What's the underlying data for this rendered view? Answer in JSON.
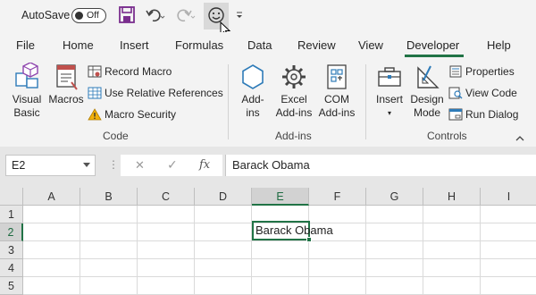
{
  "qat": {
    "autosave_label": "AutoSave",
    "autosave_state": "Off",
    "icons": [
      "save-icon",
      "undo-icon",
      "redo-icon",
      "smiley-icon",
      "customize-dropdown-icon"
    ]
  },
  "tabs": [
    "File",
    "Home",
    "Insert",
    "Formulas",
    "Data",
    "Review",
    "View",
    "Developer",
    "Help"
  ],
  "active_tab": "Developer",
  "ribbon": {
    "code": {
      "visual_basic_line1": "Visual",
      "visual_basic_line2": "Basic",
      "macros": "Macros",
      "record_macro": "Record Macro",
      "use_relative_references": "Use Relative References",
      "macro_security": "Macro Security",
      "label": "Code"
    },
    "addins": {
      "addins_line1": "Add-",
      "addins_line2": "ins",
      "excel_line1": "Excel",
      "excel_line2": "Add-ins",
      "com_line1": "COM",
      "com_line2": "Add-ins",
      "label": "Add-ins"
    },
    "controls": {
      "insert": "Insert",
      "design_line1": "Design",
      "design_line2": "Mode",
      "properties": "Properties",
      "view_code": "View Code",
      "run_dialog": "Run Dialog",
      "label": "Controls"
    }
  },
  "formula_bar": {
    "name_box": "E2",
    "cancel_icon": "✕",
    "enter_icon": "✓",
    "fx_label": "fx",
    "content": "Barack Obama"
  },
  "grid": {
    "columns": [
      "A",
      "B",
      "C",
      "D",
      "E",
      "F",
      "G",
      "H",
      "I"
    ],
    "rows": [
      "1",
      "2",
      "3",
      "4",
      "5"
    ],
    "selected_column": "E",
    "selected_row": "2",
    "cells": {
      "E2": "Barack Obama"
    }
  },
  "colors": {
    "accent": "#217346",
    "ribbon_bg": "#f3f3f3",
    "grid_header_bg": "#e6e6e6"
  }
}
